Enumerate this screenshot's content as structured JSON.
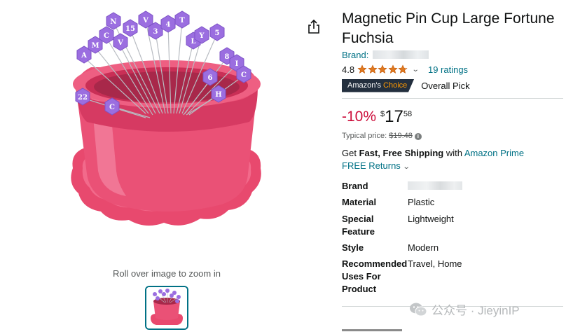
{
  "product": {
    "title": "Magnetic Pin Cup Large Fortune Fuchsia",
    "brand_label": "Brand: ",
    "rating": "4.8",
    "rating_count": "19 ratings",
    "stars_filled": 4.8,
    "choice_badge_prefix": "Amazon's ",
    "choice_badge_suffix": "Choice",
    "choice_label": "Overall Pick"
  },
  "price": {
    "discount": "-10%",
    "currency": "$",
    "whole": "17",
    "fraction": "58",
    "typical_label": "Typical price: ",
    "typical_value": "$19.48",
    "info_icon": "i"
  },
  "shipping": {
    "prefix": "Get ",
    "bold": "Fast, Free Shipping",
    "middle": " with ",
    "prime": "Amazon Prime",
    "returns": "FREE Returns",
    "returns_chevron": "⌄"
  },
  "specs": [
    {
      "key": "Brand",
      "value": ""
    },
    {
      "key": "Material",
      "value": "Plastic"
    },
    {
      "key": "Special Feature",
      "value": "Lightweight"
    },
    {
      "key": "Style",
      "value": "Modern"
    },
    {
      "key": "Recommended Uses For Product",
      "value": "Travel, Home"
    }
  ],
  "gallery": {
    "zoom_hint": "Roll over image to zoom in"
  },
  "watermark": {
    "text": "公众号 · JieyinIP"
  },
  "icons": {
    "share": "share-icon",
    "chevron": "⌄"
  },
  "colors": {
    "link": "#007185",
    "discount": "#cc0c39",
    "star": "#de7921",
    "badge_bg": "#232f3e",
    "badge_accent": "#ff9900",
    "cup": "#e8496e",
    "pin_head": "#9b6ee0"
  }
}
